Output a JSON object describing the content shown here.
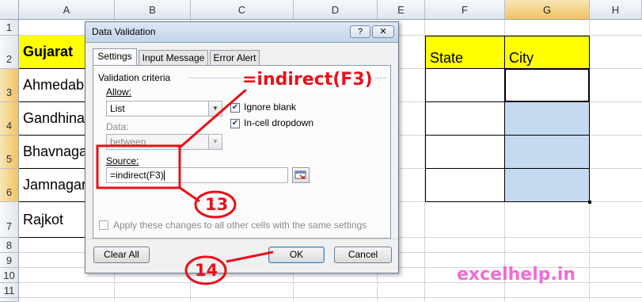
{
  "columns": [
    "A",
    "B",
    "C",
    "D",
    "E",
    "F",
    "G",
    "H"
  ],
  "rows": [
    "1",
    "2",
    "3",
    "4",
    "5",
    "6",
    "7",
    "8",
    "9",
    "10",
    "11"
  ],
  "cells": {
    "a2": "Gujarat",
    "a3": "Ahmedab",
    "a4": "Gandhina",
    "a5": "Bhavnaga",
    "a6": "Jamnagar",
    "a7": "Rajkot",
    "f2": "State",
    "g2": "City"
  },
  "dialog": {
    "title": "Data Validation",
    "help": "?",
    "close": "✕",
    "tabs": [
      "Settings",
      "Input Message",
      "Error Alert"
    ],
    "criteria_label": "Validation criteria",
    "allow_label": "Allow:",
    "allow_value": "List",
    "data_label": "Data:",
    "data_value": "between",
    "ignore_blank": "Ignore blank",
    "in_cell_dropdown": "In-cell dropdown",
    "source_label": "Source:",
    "source_value": "=indirect(F3)",
    "apply_all": "Apply these changes to all other cells with the same settings",
    "clear_all": "Clear All",
    "ok": "OK",
    "cancel": "Cancel"
  },
  "annotations": {
    "formula": "=indirect(F3)",
    "step13": "13",
    "step14": "14",
    "watermark": "excelhelp.in"
  },
  "colors": {
    "highlight_yellow": "#ffff00",
    "selected_blue": "#c5d9f1",
    "annotation_red": "#e8101a",
    "watermark_pink": "#f26bd3"
  }
}
